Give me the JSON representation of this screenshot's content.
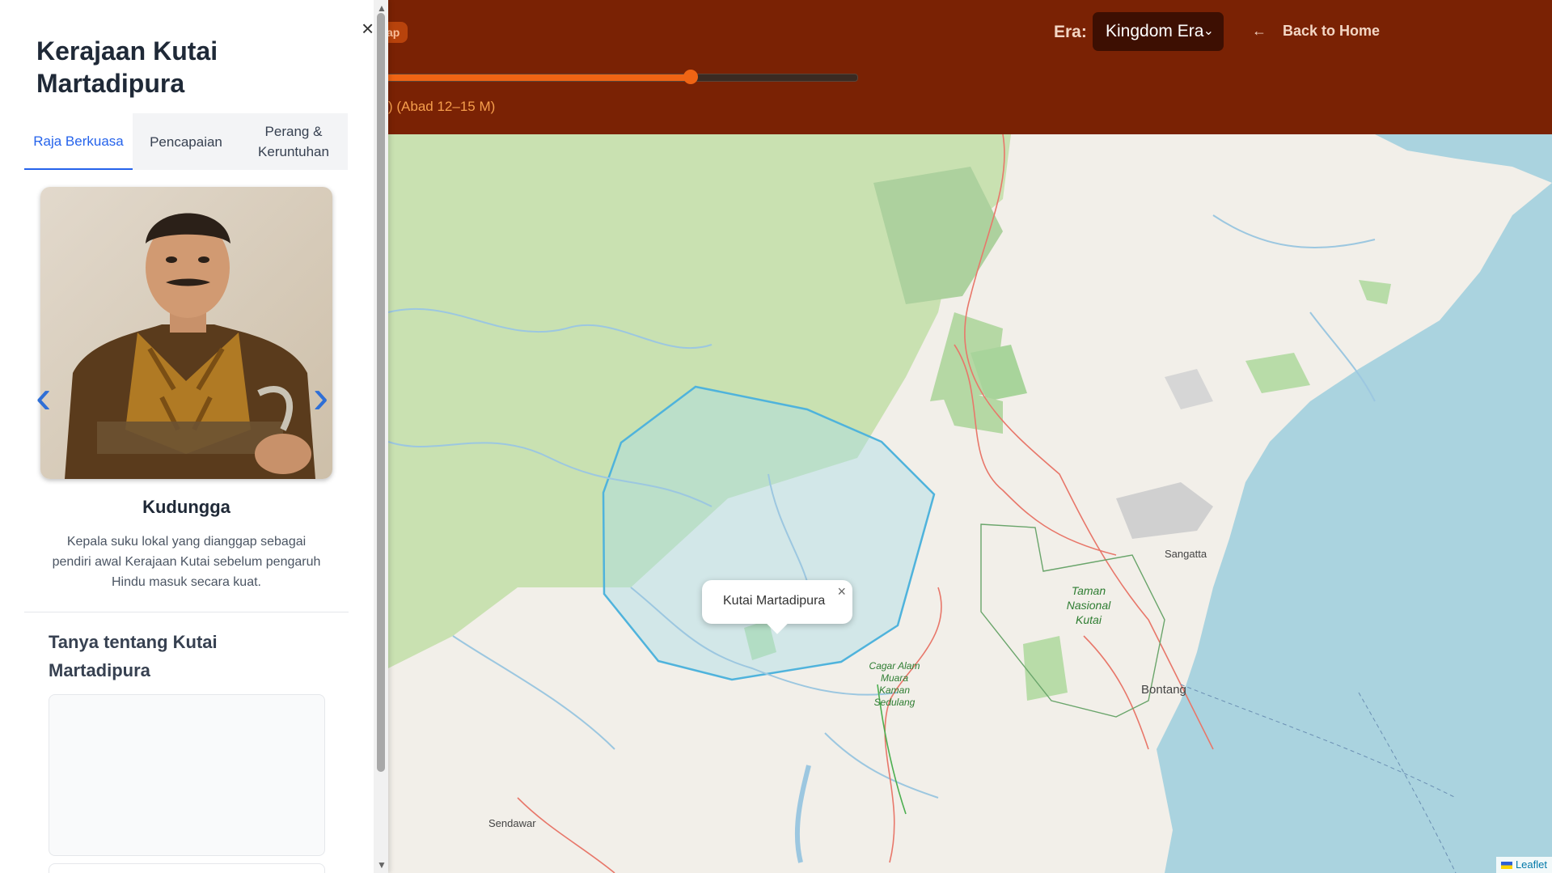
{
  "header": {
    "badge": "ap",
    "period_label": ") (Abad 12–15 M)",
    "slider_value": 0.65,
    "era_label": "Era:",
    "era_selected": "Kingdom Era",
    "back_label": "Back to Home",
    "back_icon": "←"
  },
  "map": {
    "popup_text": "Kutai Martadipura",
    "popup_close": "×",
    "attribution": "Leaflet",
    "places": {
      "sangatta": "Sangatta",
      "bontang": "Bontang",
      "sendawar": "Sendawar",
      "taman_line1": "Taman",
      "taman_line2": "Nasional",
      "taman_line3": "Kutai",
      "cagar_line1": "Cagar Alam",
      "cagar_line2": "Muara",
      "cagar_line3": "Kaman",
      "cagar_line4": "Sedulang"
    }
  },
  "sidebar": {
    "close": "×",
    "title": "Kerajaan Kutai Martadipura",
    "tabs": [
      {
        "label": "Raja Berkuasa"
      },
      {
        "label": "Pencapaian"
      },
      {
        "label": "Perang & Keruntuhan"
      }
    ],
    "active_tab": 0,
    "king": {
      "name": "Kudungga",
      "description": "Kepala suku lokal yang dianggap sebagai pendiri awal Kerajaan Kutai sebelum pengaruh Hindu masuk secara kuat."
    },
    "carousel": {
      "prev_icon": "‹",
      "next_icon": "›"
    },
    "ask_title": "Tanya tentang Kutai Martadipura"
  }
}
